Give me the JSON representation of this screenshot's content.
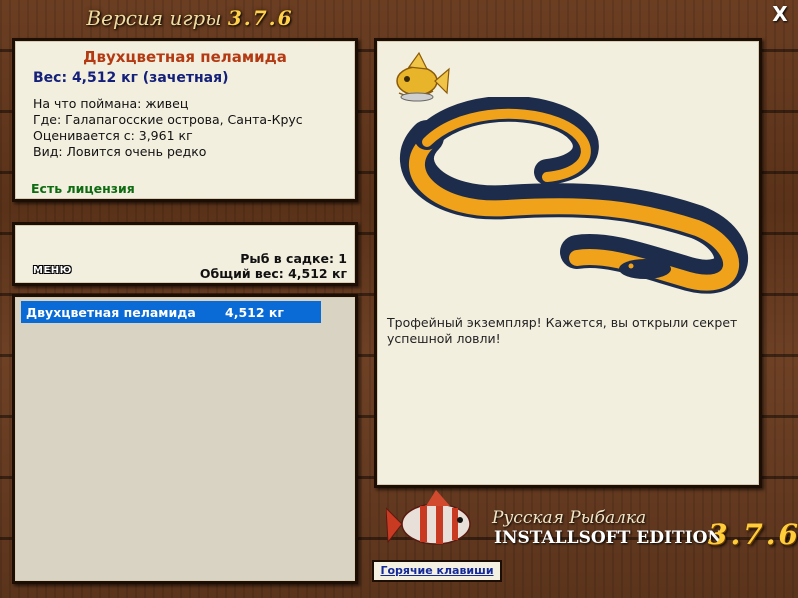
{
  "window": {
    "title_prefix": "Версия игры",
    "title_version": "3.7.6",
    "close_label": "X"
  },
  "fish_info": {
    "name": "Двухцветная пеламида",
    "weight": "Вес: 4,512 кг (зачетная)",
    "bait": "На что поймана: живец",
    "location": "Где: Галапагосские острова, Санта-Крус",
    "rated_from": "Оценивается с: 3,961 кг",
    "rarity": "Вид: Ловится очень редко",
    "license": "Есть лицензия"
  },
  "keepnet": {
    "menu_label": "МЕНЮ",
    "fish_count": "Рыб в садке: 1",
    "total_weight": "Общий вес: 4,512 кг"
  },
  "catch_list": [
    {
      "name": "Двухцветная пеламида",
      "weight": "4,512 кг"
    }
  ],
  "photo": {
    "description": "Трофейный экземпляр! Кажется, вы открыли секрет успешной ловли!"
  },
  "branding": {
    "line1": "Русская Рыбалка",
    "line2": "INSTALLSOFT EDITION",
    "version": "3.7.6"
  },
  "hotkeys_label": "Горячие клавиши",
  "colors": {
    "fish_name": "#b33a12",
    "weight": "#14207a",
    "license": "#0e6b12",
    "selection": "#0a6ad6",
    "version_gold": "#ffcc3a"
  }
}
